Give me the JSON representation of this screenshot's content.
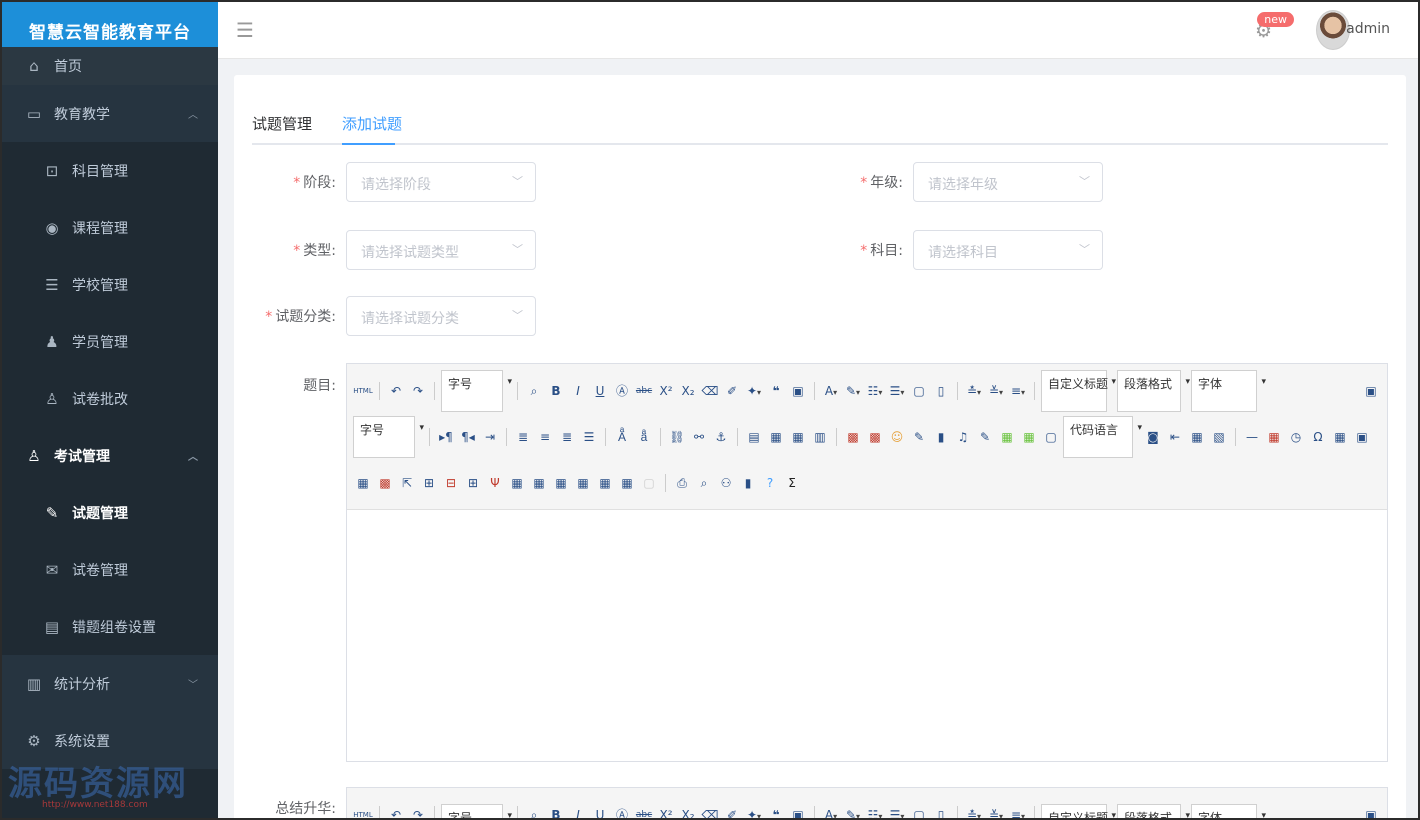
{
  "app": {
    "title": "智慧云智能教育平台"
  },
  "header": {
    "notice_badge": "new",
    "username": "admin"
  },
  "sidebar": {
    "items": [
      {
        "label": "首页",
        "icon": "home-icon",
        "type": "top"
      },
      {
        "label": "教育教学",
        "icon": "wallet-icon",
        "type": "group",
        "arrow": "︿"
      },
      {
        "label": "科目管理",
        "icon": "briefcase-icon",
        "type": "sub"
      },
      {
        "label": "课程管理",
        "icon": "eye-icon",
        "type": "sub"
      },
      {
        "label": "学校管理",
        "icon": "school-icon",
        "type": "sub"
      },
      {
        "label": "学员管理",
        "icon": "student-icon",
        "type": "sub"
      },
      {
        "label": "试卷批改",
        "icon": "grading-icon",
        "type": "sub"
      },
      {
        "label": "考试管理",
        "icon": "exam-icon",
        "type": "group-active",
        "arrow": "︿"
      },
      {
        "label": "试题管理",
        "icon": "edit-icon",
        "type": "sub-active"
      },
      {
        "label": "试卷管理",
        "icon": "envelope-icon",
        "type": "sub"
      },
      {
        "label": "错题组卷设置",
        "icon": "document-icon",
        "type": "sub"
      },
      {
        "label": "统计分析",
        "icon": "chart-icon",
        "type": "group",
        "arrow": "﹀"
      },
      {
        "label": "系统设置",
        "icon": "settings-icon",
        "type": "group"
      }
    ]
  },
  "tabs": [
    {
      "label": "试题管理"
    },
    {
      "label": "添加试题"
    }
  ],
  "form": {
    "stage": {
      "label": "阶段:",
      "placeholder": "请选择阶段"
    },
    "grade": {
      "label": "年级:",
      "placeholder": "请选择年级"
    },
    "type": {
      "label": "类型:",
      "placeholder": "请选择试题类型"
    },
    "subject": {
      "label": "科目:",
      "placeholder": "请选择科目"
    },
    "category": {
      "label": "试题分类:",
      "placeholder": "请选择试题分类"
    },
    "question": {
      "label": "题目:"
    },
    "summary": {
      "label": "总结升华:"
    }
  },
  "editor": {
    "combo_fontsize": "字号",
    "combo_heading": "自定义标题",
    "combo_paragraph": "段落格式",
    "combo_font": "字体",
    "combo_code": "代码语言",
    "html_label": "HTML"
  },
  "watermark": {
    "text": "源码资源网",
    "url": "http://www.net188.com"
  }
}
